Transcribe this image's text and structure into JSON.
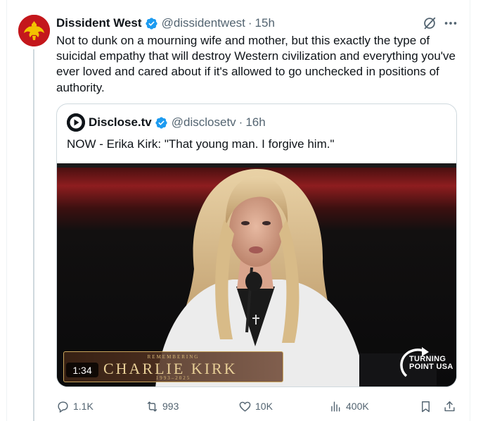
{
  "post": {
    "author_name": "Dissident West",
    "handle": "@dissidentwest",
    "separator": "·",
    "time": "15h",
    "text": "Not to dunk on a mourning wife and mother, but this exactly the type of suicidal empathy that will destroy Western civilization and everything you've ever loved and cared about if it's allowed to go unchecked in positions of authority."
  },
  "quote": {
    "author_name": "Disclose.tv",
    "handle": "@disclosetv",
    "separator": "·",
    "time": "16h",
    "text": "NOW - Erika Kirk: \"That young man. I forgive him.\"",
    "video": {
      "duration": "1:34",
      "banner_top": "REMEMBERING",
      "banner_main": "CHARLIE KIRK",
      "banner_years": "1993–2025",
      "logo_line1": "TURNING",
      "logo_line2": "POINT USA"
    }
  },
  "actions": {
    "replies": "1.1K",
    "reposts": "993",
    "likes": "10K",
    "views": "400K"
  },
  "icons": {
    "verified": "verified-badge-icon",
    "grok": "grok-icon",
    "more": "more-icon",
    "reply": "reply-icon",
    "repost": "repost-icon",
    "like": "like-icon",
    "views": "views-icon",
    "bookmark": "bookmark-icon",
    "share": "share-icon"
  },
  "colors": {
    "verified": "#1d9bf0",
    "text": "#0f1419",
    "secondary": "#536471",
    "border": "#cfd9de"
  }
}
